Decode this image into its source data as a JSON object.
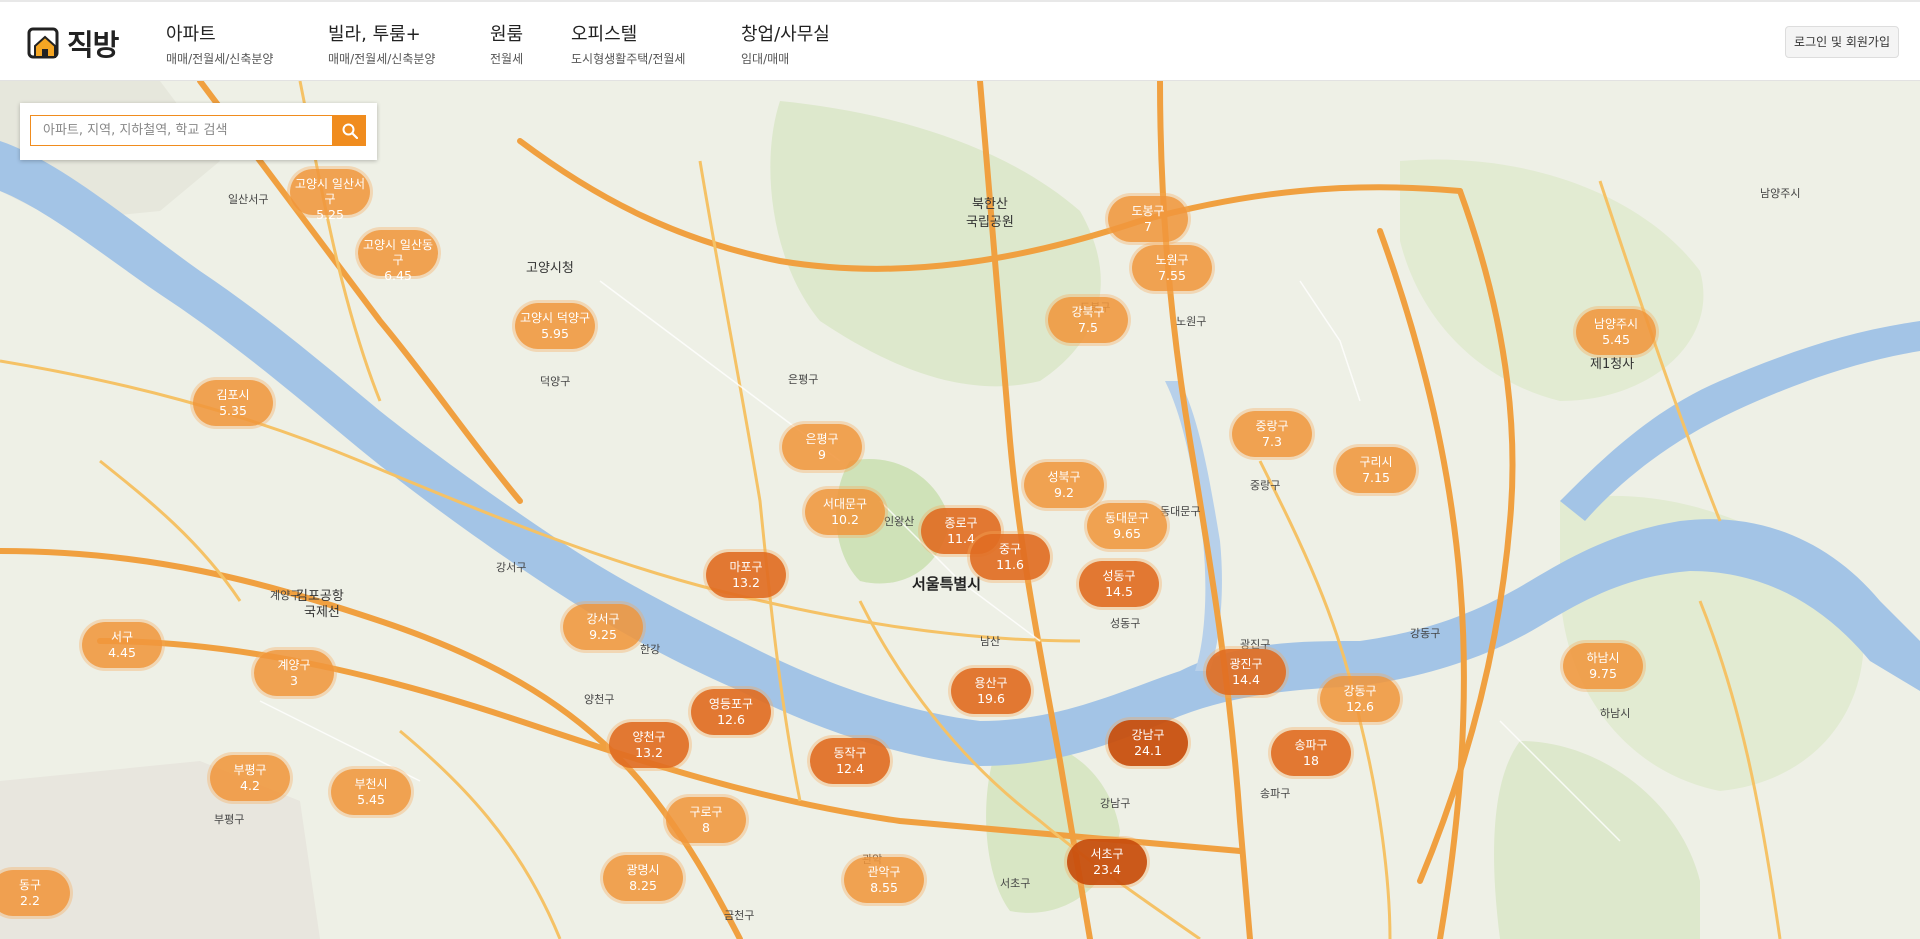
{
  "header": {
    "logo_text": "직방",
    "nav": [
      {
        "title": "아파트",
        "sub": "매매/전월세/신축분양"
      },
      {
        "title": "빌라, 투룸+",
        "sub": "매매/전월세/신축분양"
      },
      {
        "title": "원룸",
        "sub": "전월세"
      },
      {
        "title": "오피스텔",
        "sub": "도시형생활주택/전월세"
      },
      {
        "title": "창업/사무실",
        "sub": "임대/매매"
      }
    ],
    "login_label": "로그인 및 회원가입"
  },
  "search": {
    "placeholder": "아파트, 지역, 지하철역, 학교 검색",
    "icon": "search-icon"
  },
  "colors": {
    "accent": "#f08c1e",
    "bubble": "#f0963c",
    "bubble_hot": "#e16e23",
    "bubble_hotter": "#c8500f",
    "river": "#a3c4e6"
  },
  "districts": [
    {
      "name": "고양시 일산서구",
      "value": "5.25"
    },
    {
      "name": "고양시 일산동구",
      "value": "6.45"
    },
    {
      "name": "고양시 덕양구",
      "value": "5.95"
    },
    {
      "name": "김포시",
      "value": "5.35"
    },
    {
      "name": "도봉구",
      "value": "7"
    },
    {
      "name": "노원구",
      "value": "7.55"
    },
    {
      "name": "강북구",
      "value": "7.5"
    },
    {
      "name": "남양주시",
      "value": "5.45"
    },
    {
      "name": "은평구",
      "value": "9"
    },
    {
      "name": "중랑구",
      "value": "7.3"
    },
    {
      "name": "구리시",
      "value": "7.15"
    },
    {
      "name": "성북구",
      "value": "9.2"
    },
    {
      "name": "서대문구",
      "value": "10.2"
    },
    {
      "name": "종로구",
      "value": "11.4"
    },
    {
      "name": "동대문구",
      "value": "9.65"
    },
    {
      "name": "마포구",
      "value": "13.2"
    },
    {
      "name": "중구",
      "value": "11.6"
    },
    {
      "name": "성동구",
      "value": "14.5"
    },
    {
      "name": "강서구",
      "value": "9.25"
    },
    {
      "name": "서구",
      "value": "4.45"
    },
    {
      "name": "계양구",
      "value": "3"
    },
    {
      "name": "용산구",
      "value": "19.6"
    },
    {
      "name": "광진구",
      "value": "14.4"
    },
    {
      "name": "강동구",
      "value": "12.6"
    },
    {
      "name": "하남시",
      "value": "9.75"
    },
    {
      "name": "영등포구",
      "value": "12.6"
    },
    {
      "name": "양천구",
      "value": "13.2"
    },
    {
      "name": "동작구",
      "value": "12.4"
    },
    {
      "name": "강남구",
      "value": "24.1"
    },
    {
      "name": "송파구",
      "value": "18"
    },
    {
      "name": "부평구",
      "value": "4.2"
    },
    {
      "name": "부천시",
      "value": "5.45"
    },
    {
      "name": "구로구",
      "value": "8"
    },
    {
      "name": "서초구",
      "value": "23.4"
    },
    {
      "name": "광명시",
      "value": "8.25"
    },
    {
      "name": "관악구",
      "value": "8.55"
    },
    {
      "name": "동구",
      "value": "2.2"
    }
  ],
  "map_labels": [
    "고양시청",
    "서울특별시",
    "제1청사",
    "북한산",
    "국립공원",
    "강서구",
    "양천구",
    "성동구",
    "동대문구",
    "강남구",
    "서초구",
    "송파구",
    "강동구",
    "광진구",
    "일산서구",
    "계양구",
    "부평구",
    "금천구",
    "관악",
    "중랑구",
    "인왕산",
    "남산",
    "한강",
    "김포공항",
    "국제선",
    "덕양구",
    "은평구",
    "도봉구",
    "노원구",
    "하남시",
    "남양주시"
  ]
}
